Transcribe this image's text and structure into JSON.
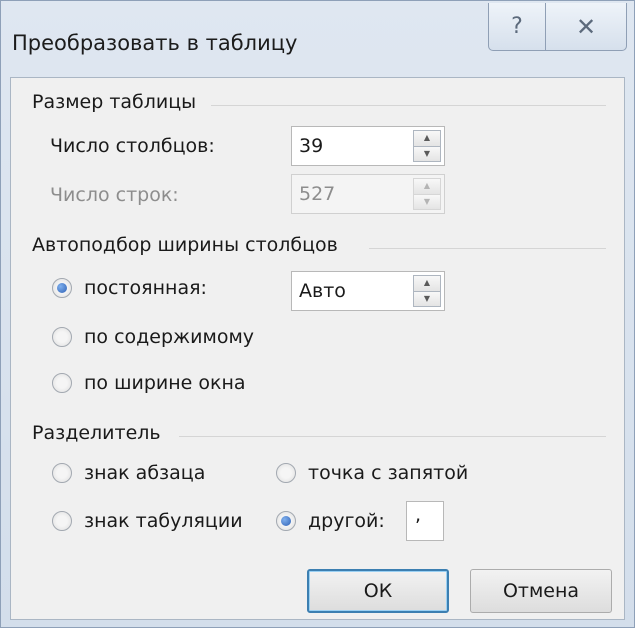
{
  "dialog": {
    "title": "Преобразовать в таблицу",
    "help_glyph": "?",
    "close_glyph": "✕"
  },
  "size_group": {
    "title": "Размер таблицы",
    "columns_label": "Число столбцов:",
    "columns_value": "39",
    "rows_label": "Число строк:",
    "rows_value": "527"
  },
  "autofit_group": {
    "title": "Автоподбор ширины столбцов",
    "options": [
      {
        "label": "постоянная:",
        "selected": true
      },
      {
        "label": "по содержимому",
        "selected": false
      },
      {
        "label": "по ширине окна",
        "selected": false
      }
    ],
    "fixed_value": "Авто"
  },
  "separator_group": {
    "title": "Разделитель",
    "options": [
      {
        "label": "знак абзаца",
        "selected": false
      },
      {
        "label": "точка с запятой",
        "selected": false
      },
      {
        "label": "знак табуляции",
        "selected": false
      },
      {
        "label": "другой:",
        "selected": true
      }
    ],
    "other_value": ","
  },
  "buttons": {
    "ok": "ОК",
    "cancel": "Отмена"
  },
  "colors": {
    "accent": "#2f61b5",
    "default_button_border": "#3c7fb1"
  }
}
